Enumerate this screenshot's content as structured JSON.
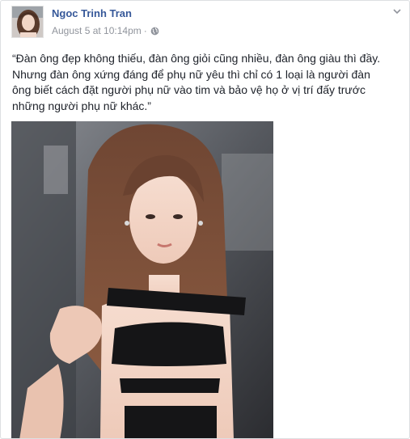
{
  "post": {
    "author_name": "Ngoc Trinh Tran",
    "date": "August 5 at 10:14pm",
    "separator": "·",
    "privacy_icon": "globe-icon",
    "options_icon": "chevron-down-icon",
    "text_lines": [
      "“Đàn ông đẹp không thiếu, đàn ông giỏi cũng nhiều, đàn ông giàu thì đầy.",
      "Nhưng đàn ông xứng đáng để phụ nữ yêu thì chỉ có 1 loại là người đàn",
      "ông biết cách đặt người phụ nữ vào tim và bảo vệ họ ở vị trí đấy trước",
      "những người phụ nữ khác.”"
    ]
  },
  "colors": {
    "author_link": "#365899",
    "meta_gray": "#90949c",
    "text": "#1d2129",
    "border": "#dddfe2"
  }
}
